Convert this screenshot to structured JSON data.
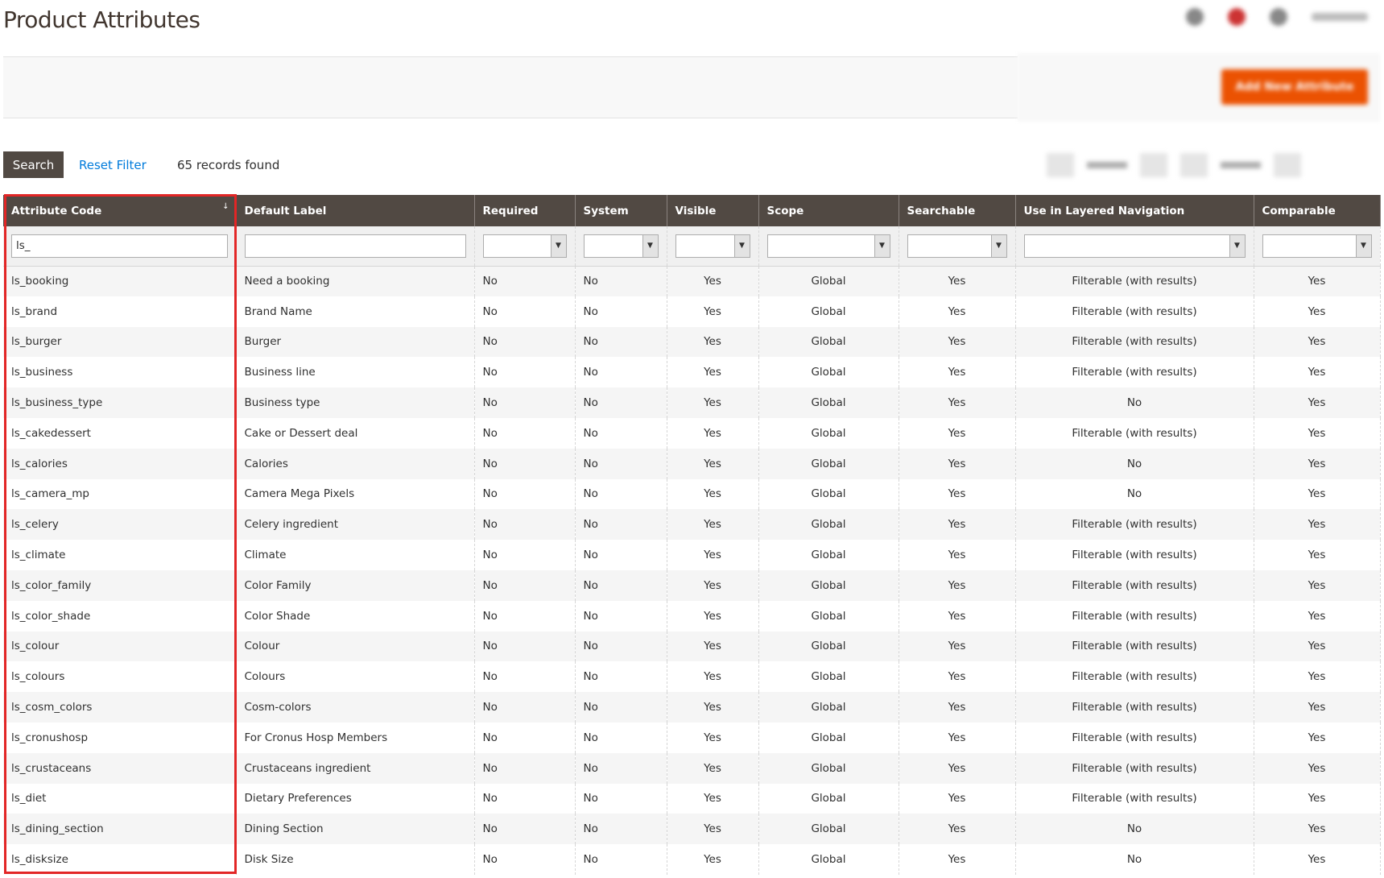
{
  "page_title": "Product Attributes",
  "header": {
    "add_button_label": "Add New Attribute"
  },
  "toolbar": {
    "search_label": "Search",
    "reset_label": "Reset Filter",
    "records_found": "65 records found"
  },
  "columns": [
    "Attribute Code",
    "Default Label",
    "Required",
    "System",
    "Visible",
    "Scope",
    "Searchable",
    "Use in Layered Navigation",
    "Comparable"
  ],
  "filters": {
    "attribute_code": "ls_"
  },
  "rows": [
    [
      "ls_booking",
      "Need a booking",
      "No",
      "No",
      "Yes",
      "Global",
      "Yes",
      "Filterable (with results)",
      "Yes"
    ],
    [
      "ls_brand",
      "Brand Name",
      "No",
      "No",
      "Yes",
      "Global",
      "Yes",
      "Filterable (with results)",
      "Yes"
    ],
    [
      "ls_burger",
      "Burger",
      "No",
      "No",
      "Yes",
      "Global",
      "Yes",
      "Filterable (with results)",
      "Yes"
    ],
    [
      "ls_business",
      "Business line",
      "No",
      "No",
      "Yes",
      "Global",
      "Yes",
      "Filterable (with results)",
      "Yes"
    ],
    [
      "ls_business_type",
      "Business type",
      "No",
      "No",
      "Yes",
      "Global",
      "Yes",
      "No",
      "Yes"
    ],
    [
      "ls_cakedessert",
      "Cake or Dessert deal",
      "No",
      "No",
      "Yes",
      "Global",
      "Yes",
      "Filterable (with results)",
      "Yes"
    ],
    [
      "ls_calories",
      "Calories",
      "No",
      "No",
      "Yes",
      "Global",
      "Yes",
      "No",
      "Yes"
    ],
    [
      "ls_camera_mp",
      "Camera Mega Pixels",
      "No",
      "No",
      "Yes",
      "Global",
      "Yes",
      "No",
      "Yes"
    ],
    [
      "ls_celery",
      "Celery ingredient",
      "No",
      "No",
      "Yes",
      "Global",
      "Yes",
      "Filterable (with results)",
      "Yes"
    ],
    [
      "ls_climate",
      "Climate",
      "No",
      "No",
      "Yes",
      "Global",
      "Yes",
      "Filterable (with results)",
      "Yes"
    ],
    [
      "ls_color_family",
      "Color Family",
      "No",
      "No",
      "Yes",
      "Global",
      "Yes",
      "Filterable (with results)",
      "Yes"
    ],
    [
      "ls_color_shade",
      "Color Shade",
      "No",
      "No",
      "Yes",
      "Global",
      "Yes",
      "Filterable (with results)",
      "Yes"
    ],
    [
      "ls_colour",
      "Colour",
      "No",
      "No",
      "Yes",
      "Global",
      "Yes",
      "Filterable (with results)",
      "Yes"
    ],
    [
      "ls_colours",
      "Colours",
      "No",
      "No",
      "Yes",
      "Global",
      "Yes",
      "Filterable (with results)",
      "Yes"
    ],
    [
      "ls_cosm_colors",
      "Cosm-colors",
      "No",
      "No",
      "Yes",
      "Global",
      "Yes",
      "Filterable (with results)",
      "Yes"
    ],
    [
      "ls_cronushosp",
      "For Cronus Hosp Members",
      "No",
      "No",
      "Yes",
      "Global",
      "Yes",
      "Filterable (with results)",
      "Yes"
    ],
    [
      "ls_crustaceans",
      "Crustaceans ingredient",
      "No",
      "No",
      "Yes",
      "Global",
      "Yes",
      "Filterable (with results)",
      "Yes"
    ],
    [
      "ls_diet",
      "Dietary Preferences",
      "No",
      "No",
      "Yes",
      "Global",
      "Yes",
      "Filterable (with results)",
      "Yes"
    ],
    [
      "ls_dining_section",
      "Dining Section",
      "No",
      "No",
      "Yes",
      "Global",
      "Yes",
      "No",
      "Yes"
    ],
    [
      "ls_disksize",
      "Disk Size",
      "No",
      "No",
      "Yes",
      "Global",
      "Yes",
      "No",
      "Yes"
    ]
  ],
  "colors": {
    "header_bg": "#514943",
    "accent": "#eb5202",
    "link": "#007bdb",
    "highlight": "#e22626"
  }
}
